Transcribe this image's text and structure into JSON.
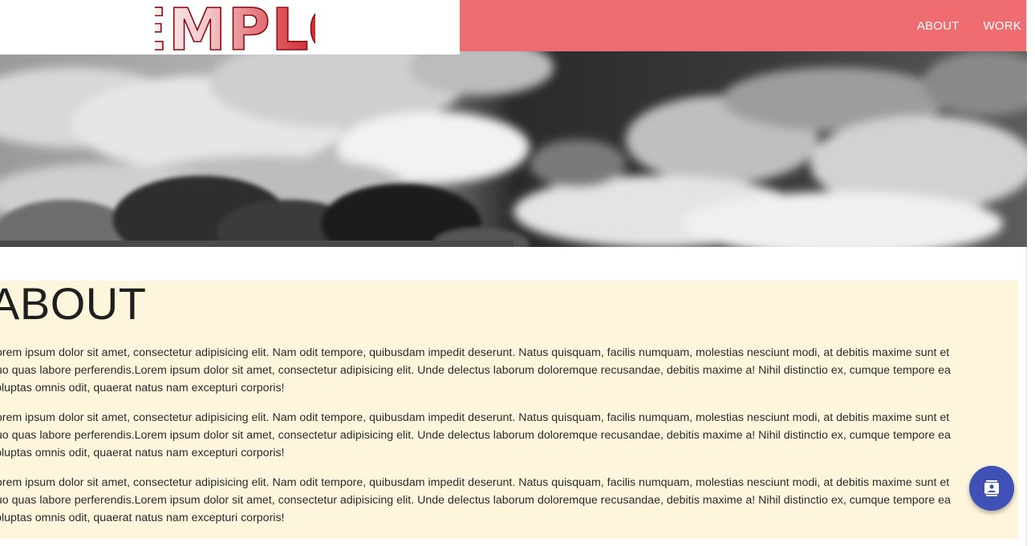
{
  "header": {
    "logo_text": "EMPLO",
    "nav": [
      {
        "label": "ABOUT"
      },
      {
        "label": "WORK"
      }
    ]
  },
  "hero": {
    "image": "black-and-white clouds and treetops"
  },
  "about": {
    "title": "ABOUT",
    "paragraphs": [
      {
        "lines": [
          "Lorem ipsum dolor sit amet, consectetur adipisicing elit. Nam odit tempore, quibusdam impedit deserunt. Natus quisquam, facilis numquam, molestias nesciunt modi, at debitis maxime sunt et",
          "quo quas labore perferendis.Lorem ipsum dolor sit amet, consectetur adipisicing elit. Unde delectus laborum doloremque recusandae, debitis maxime a! Nihil distinctio ex, cumque tempore ea",
          "voluptas omnis odit, quaerat natus nam excepturi corporis!"
        ]
      },
      {
        "lines": [
          "Lorem ipsum dolor sit amet, consectetur adipisicing elit. Nam odit tempore, quibusdam impedit deserunt. Natus quisquam, facilis numquam, molestias nesciunt modi, at debitis maxime sunt et",
          "quo quas labore perferendis.Lorem ipsum dolor sit amet, consectetur adipisicing elit. Unde delectus laborum doloremque recusandae, debitis maxime a! Nihil distinctio ex, cumque tempore ea",
          "voluptas omnis odit, quaerat natus nam excepturi corporis!"
        ]
      },
      {
        "lines": [
          "Lorem ipsum dolor sit amet, consectetur adipisicing elit. Nam odit tempore, quibusdam impedit deserunt. Natus quisquam, facilis numquam, molestias nesciunt modi, at debitis maxime sunt et",
          "quo quas labore perferendis.Lorem ipsum dolor sit amet, consectetur adipisicing elit. Unde delectus laborum doloremque recusandae, debitis maxime a! Nihil distinctio ex, cumque tempore ea",
          "voluptas omnis odit, quaerat natus nam excepturi corporis!"
        ]
      }
    ]
  },
  "fab": {
    "icon": "contact-card-icon"
  },
  "colors": {
    "topbar": "#ef6c71",
    "about_bg": "#fdf6dc",
    "fab": "#3f51b5",
    "logo_red": "#c4161c"
  }
}
